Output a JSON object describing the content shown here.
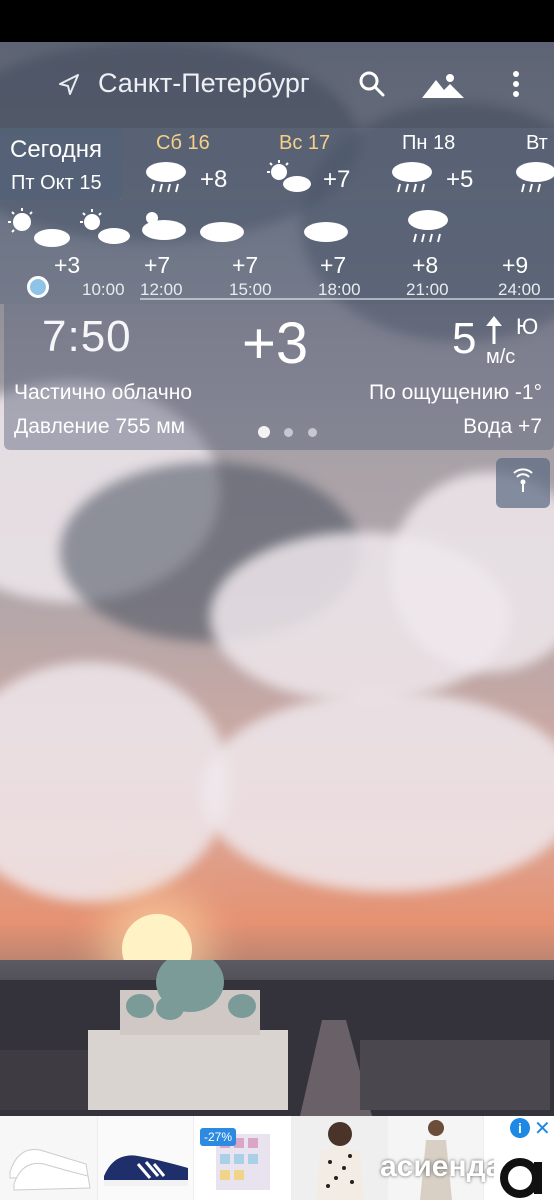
{
  "header": {
    "city": "Санкт-Петербург",
    "icons": [
      "location-arrow-icon",
      "search-icon",
      "landscape-icon",
      "more-vert-icon"
    ]
  },
  "today": {
    "label": "Сегодня",
    "date": "Пт Окт 15"
  },
  "days": [
    {
      "label": "Сб 16",
      "temp": "+8",
      "icon": "rain-icon",
      "weekend": true
    },
    {
      "label": "Вс 17",
      "temp": "+7",
      "icon": "sun-cloud-icon",
      "weekend": true
    },
    {
      "label": "Пн 18",
      "temp": "+5",
      "icon": "rain-icon",
      "weekend": false
    },
    {
      "label": "Вт",
      "temp": "",
      "icon": "rain-icon",
      "weekend": false
    }
  ],
  "hourly": [
    {
      "temp": "+3",
      "time": "10:00",
      "icon": "sun-cloud-icon"
    },
    {
      "temp": "+7",
      "time": "12:00",
      "icon": "sun-cloud-icon"
    },
    {
      "temp": "+7",
      "time": "15:00",
      "icon": "partly-cloudy-icon"
    },
    {
      "temp": "+7",
      "time": "18:00",
      "icon": "cloud-icon"
    },
    {
      "temp": "+8",
      "time": "21:00",
      "icon": "cloud-icon"
    },
    {
      "temp": "+9",
      "time": "24:00",
      "icon": "rain-icon"
    }
  ],
  "current": {
    "time": "7:50",
    "temp": "+3",
    "wind_speed": "5",
    "wind_dir": "Ю",
    "wind_unit": "м/с",
    "condition": "Частично облачно",
    "feels_like": "По ощущению -1°",
    "pressure": "Давление 755 мм",
    "water": "Вода +7"
  },
  "ad": {
    "discount": "-27%",
    "brand": "асиенда.ру",
    "info": "i",
    "close": "✕"
  },
  "colors": {
    "weekend": "#f6d088",
    "accent": "#8fc3e8"
  }
}
